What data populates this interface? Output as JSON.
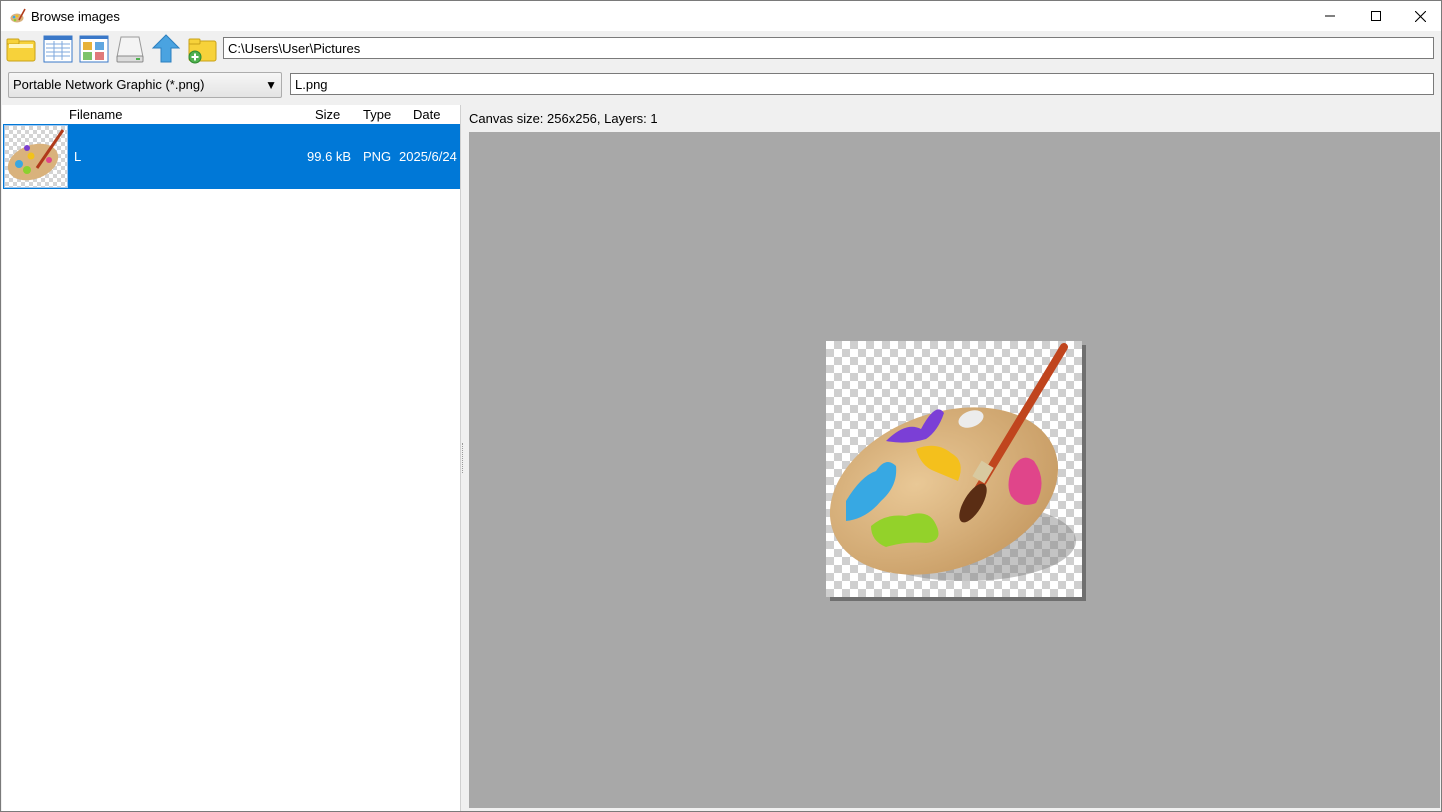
{
  "window": {
    "title": "Browse images"
  },
  "toolbar": {
    "tools": [
      "open-folder-icon",
      "details-view-icon",
      "thumbnails-view-icon",
      "drive-icon",
      "up-folder-icon",
      "new-folder-icon"
    ],
    "path_value": "C:\\Users\\User\\Pictures"
  },
  "filter": {
    "selected": "Portable Network Graphic (*.png)",
    "filename_value": "L.png"
  },
  "file_list": {
    "columns": {
      "filename": "Filename",
      "size": "Size",
      "type": "Type",
      "date": "Date"
    },
    "rows": [
      {
        "filename": "L",
        "size": "99.6 kB",
        "type": "PNG",
        "date": "2025/6/24",
        "selected": true
      }
    ]
  },
  "preview": {
    "info": "Canvas size: 256x256, Layers: 1"
  },
  "colors": {
    "selection": "#0078d7",
    "canvas_bg": "#a8a8a8"
  }
}
